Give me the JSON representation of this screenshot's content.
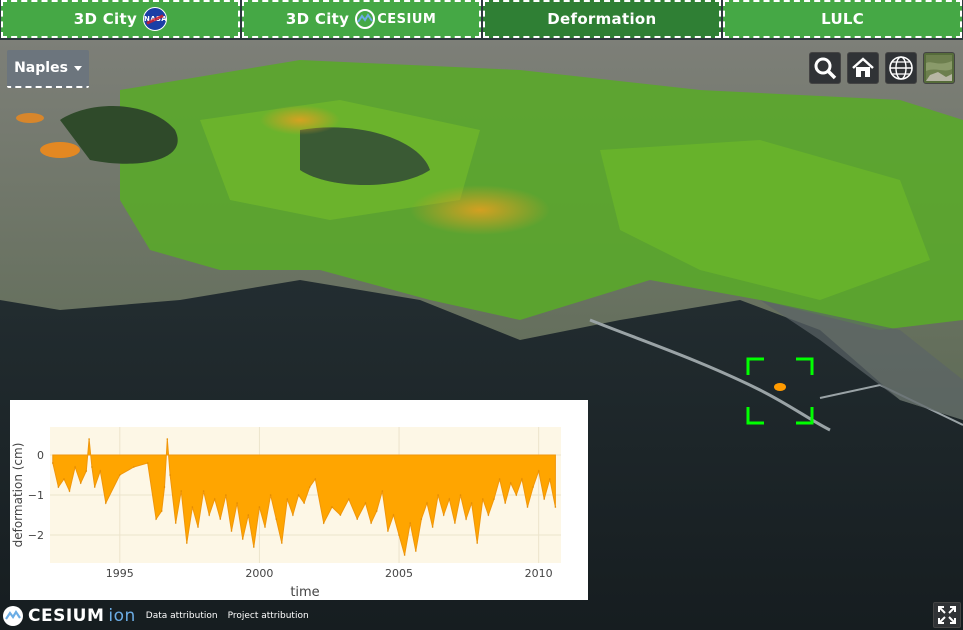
{
  "tabs": [
    {
      "label": "3D City",
      "logo": "nasa-logo",
      "logo_text": "NASA",
      "active": false
    },
    {
      "label": "3D City",
      "logo": "cesium-logo",
      "logo_text": "CESIUM",
      "active": false
    },
    {
      "label": "Deformation",
      "logo": "",
      "logo_text": "",
      "active": true
    },
    {
      "label": "LULC",
      "logo": "",
      "logo_text": "",
      "active": false
    }
  ],
  "city_select": {
    "value": "Naples"
  },
  "toolbar": {
    "icons": [
      "search-icon",
      "home-icon",
      "globe-icon",
      "imagery-picker-icon"
    ]
  },
  "colors": {
    "tab_green": "#45a845",
    "tab_active": "#2f7f34",
    "deformation_fill": "#ffa500",
    "plot_bg": "#fdf7e6",
    "selection_green": "#00ff00"
  },
  "chart_data": {
    "type": "area",
    "title": "",
    "xlabel": "time",
    "ylabel": "deformation (cm)",
    "xlim": [
      1992.5,
      2010.8
    ],
    "ylim": [
      -2.7,
      0.7
    ],
    "xticks": [
      1995,
      2000,
      2005,
      2010
    ],
    "yticks": [
      0,
      -1,
      -2
    ],
    "fill_color": "#ffa500",
    "x": [
      1992.6,
      1992.8,
      1993.0,
      1993.2,
      1993.4,
      1993.6,
      1993.8,
      1993.9,
      1994.0,
      1994.1,
      1994.3,
      1994.5,
      1995.0,
      1995.5,
      1996.0,
      1996.3,
      1996.5,
      1996.6,
      1996.7,
      1996.8,
      1997.0,
      1997.2,
      1997.4,
      1997.6,
      1997.8,
      1998.0,
      1998.2,
      1998.4,
      1998.6,
      1998.8,
      1999.0,
      1999.2,
      1999.4,
      1999.6,
      1999.8,
      2000.0,
      2000.2,
      2000.4,
      2000.6,
      2000.8,
      2001.0,
      2001.2,
      2001.4,
      2001.6,
      2001.8,
      2002.0,
      2002.3,
      2002.6,
      2002.9,
      2003.2,
      2003.5,
      2003.8,
      2004.0,
      2004.2,
      2004.4,
      2004.6,
      2004.8,
      2005.0,
      2005.2,
      2005.4,
      2005.6,
      2005.8,
      2006.0,
      2006.2,
      2006.4,
      2006.6,
      2006.8,
      2007.0,
      2007.2,
      2007.4,
      2007.6,
      2007.8,
      2008.0,
      2008.2,
      2008.4,
      2008.6,
      2008.8,
      2009.0,
      2009.2,
      2009.4,
      2009.6,
      2009.8,
      2010.0,
      2010.2,
      2010.4,
      2010.6
    ],
    "values": [
      -0.2,
      -0.8,
      -0.6,
      -0.9,
      -0.3,
      -0.7,
      -0.4,
      0.4,
      -0.3,
      -0.8,
      -0.4,
      -1.2,
      -0.5,
      -0.3,
      -0.2,
      -1.6,
      -1.4,
      -0.8,
      0.4,
      -0.5,
      -1.7,
      -0.9,
      -2.2,
      -1.3,
      -1.8,
      -0.9,
      -1.5,
      -1.1,
      -1.6,
      -1.0,
      -1.9,
      -1.2,
      -2.1,
      -1.5,
      -2.3,
      -1.3,
      -1.8,
      -1.0,
      -1.6,
      -2.2,
      -1.1,
      -1.5,
      -1.0,
      -1.2,
      -0.8,
      -0.6,
      -1.7,
      -1.3,
      -1.5,
      -1.1,
      -1.6,
      -1.2,
      -1.7,
      -1.4,
      -0.9,
      -1.9,
      -1.5,
      -2.0,
      -2.5,
      -1.7,
      -2.4,
      -1.6,
      -1.2,
      -1.8,
      -1.0,
      -1.5,
      -1.1,
      -1.7,
      -1.0,
      -1.6,
      -1.2,
      -2.2,
      -1.1,
      -1.5,
      -1.1,
      -0.6,
      -1.2,
      -0.7,
      -1.0,
      -0.6,
      -1.3,
      -0.8,
      -0.4,
      -1.1,
      -0.6,
      -1.3
    ]
  },
  "credits": {
    "logo_text": "CESIUM",
    "logo_suffix": "ion",
    "data_attribution": "Data attribution",
    "project_attribution": "Project attribution"
  }
}
